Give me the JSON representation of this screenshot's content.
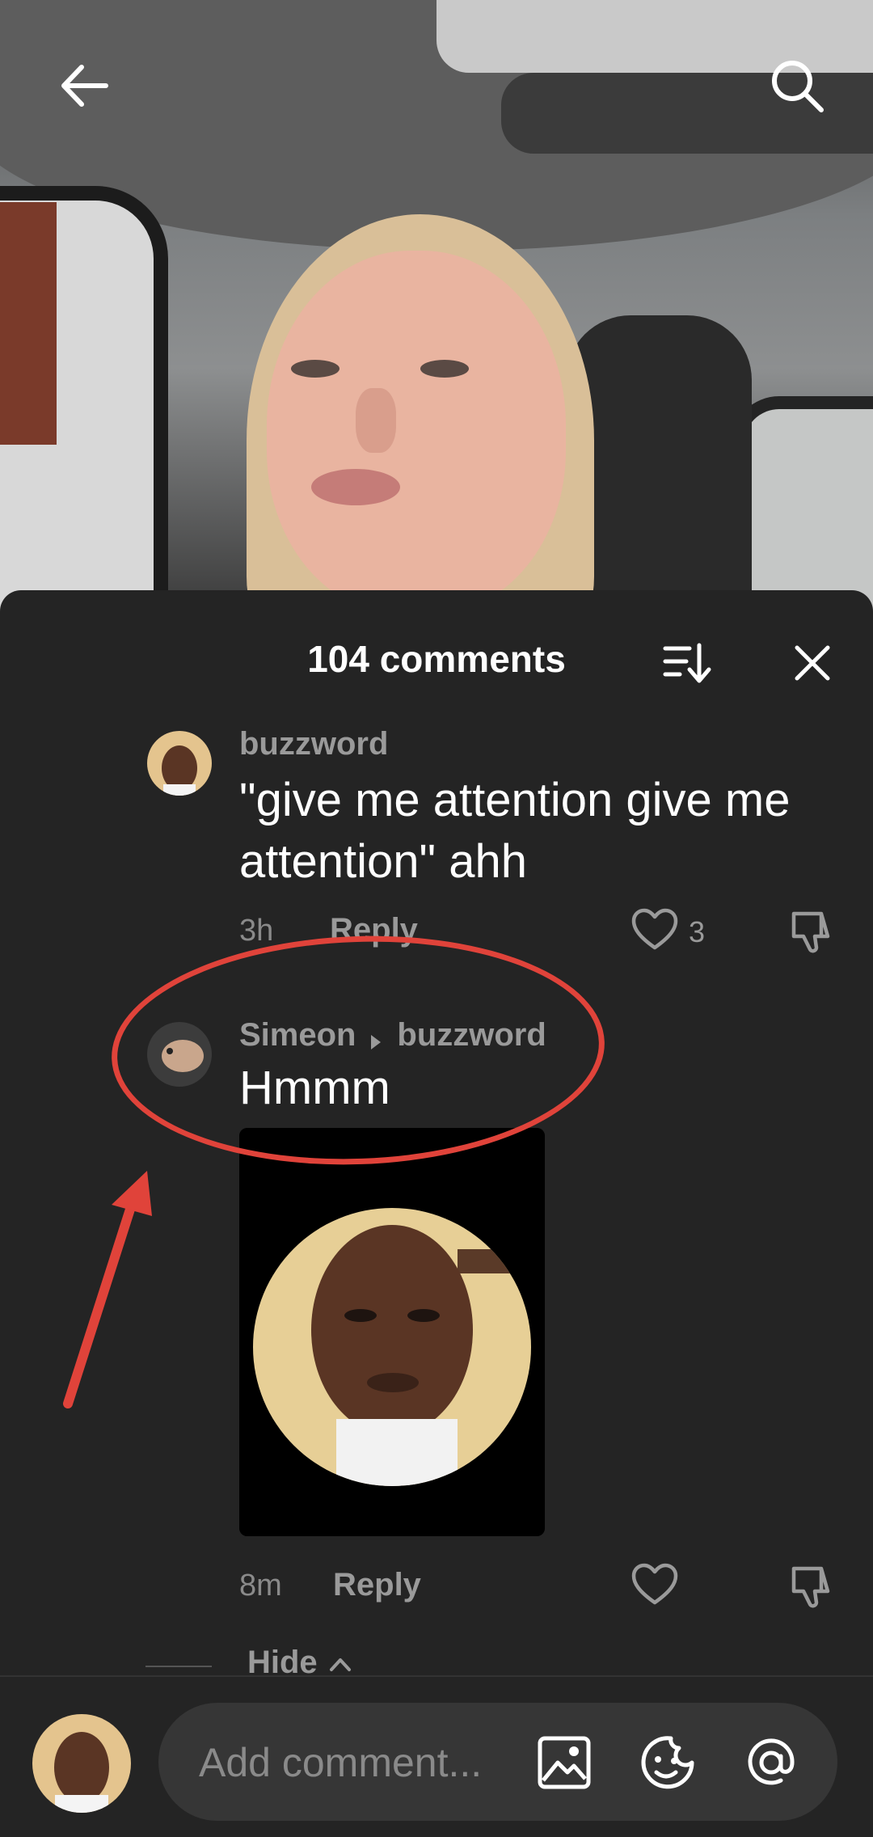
{
  "header": {
    "back_icon": "arrow-left-icon",
    "search_icon": "search-icon"
  },
  "comments_panel": {
    "title": "104 comments",
    "sort_icon": "sort-icon",
    "close_icon": "close-icon",
    "comments": [
      {
        "username": "buzzword",
        "text": "\"give me attention give me attention\" ahh",
        "time": "3h",
        "reply_label": "Reply",
        "like_count": "3"
      },
      {
        "username": "Simeon",
        "reply_to": "buzzword",
        "text": "Hmmm",
        "time": "8m",
        "reply_label": "Reply",
        "like_count": ""
      }
    ],
    "hide_label": "Hide"
  },
  "input_bar": {
    "placeholder": "Add comment...",
    "icons": [
      "image-icon",
      "emoji-icon",
      "mention-icon"
    ]
  },
  "colors": {
    "sheet_background": "#242424",
    "annotation_red": "#e0433a",
    "muted_text": "#9a9a9a"
  }
}
